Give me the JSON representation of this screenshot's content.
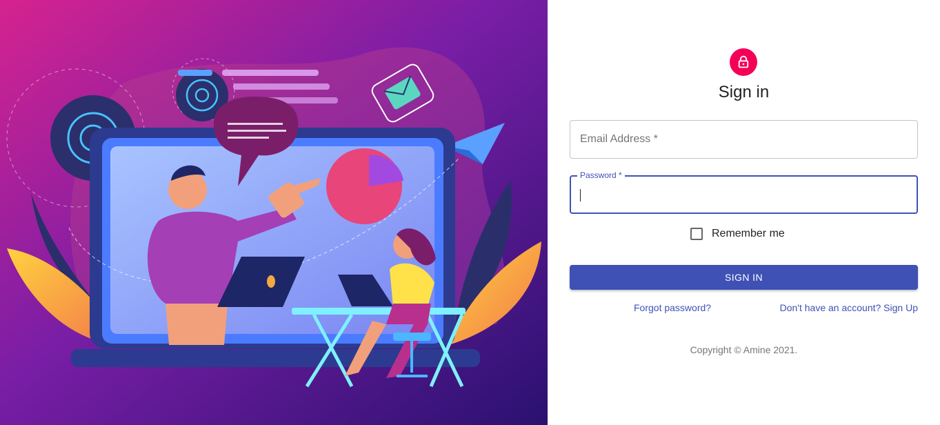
{
  "hero": {
    "illustration": "presentation-illustration"
  },
  "form": {
    "icon": "lock-icon",
    "title": "Sign in",
    "email": {
      "label": "Email Address *",
      "value": ""
    },
    "password": {
      "label": "Password *",
      "value": ""
    },
    "remember_label": "Remember me",
    "remember_checked": false,
    "submit_label": "SIGN IN",
    "forgot_link": "Forgot password?",
    "signup_link": "Don't have an account? Sign Up",
    "copyright": "Copyright © Amine 2021."
  },
  "colors": {
    "primary": "#3f51b5",
    "avatar": "#f50057",
    "hero_gradient_start": "#d6238f",
    "hero_gradient_end": "#2a1170"
  }
}
